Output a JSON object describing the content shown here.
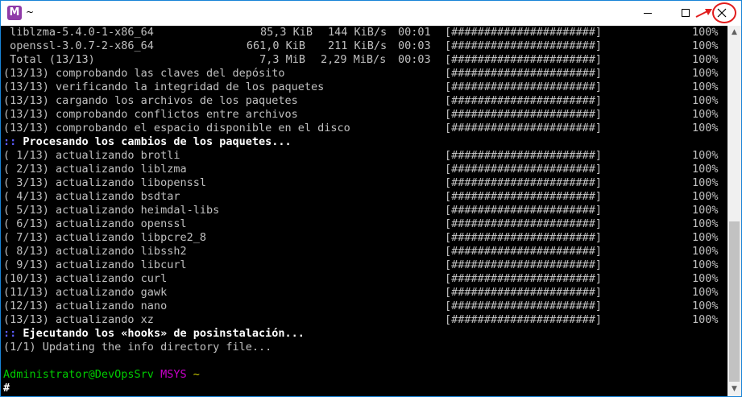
{
  "window": {
    "title": "~",
    "app_icon": "mintty-m-icon",
    "app_icon_glyph": "M"
  },
  "terminal": {
    "packages": [
      {
        "name": " liblzma-5.4.0-1-x86_64",
        "size": "85,3 KiB",
        "speed": "144 KiB/s",
        "time": "00:01",
        "bar": "[######################]",
        "pct": "100%"
      },
      {
        "name": " openssl-3.0.7-2-x86_64",
        "size": "661,0 KiB",
        "speed": "211 KiB/s",
        "time": "00:03",
        "bar": "[######################]",
        "pct": "100%"
      },
      {
        "name": " Total (13/13)",
        "size": "7,3 MiB",
        "speed": "2,29 MiB/s",
        "time": "00:03",
        "bar": "[######################]",
        "pct": "100%"
      }
    ],
    "checks": [
      {
        "text": "(13/13) comprobando las claves del depósito",
        "bar": "[######################]",
        "pct": "100%"
      },
      {
        "text": "(13/13) verificando la integridad de los paquetes",
        "bar": "[######################]",
        "pct": "100%"
      },
      {
        "text": "(13/13) cargando los archivos de los paquetes",
        "bar": "[######################]",
        "pct": "100%"
      },
      {
        "text": "(13/13) comprobando conflictos entre archivos",
        "bar": "[######################]",
        "pct": "100%"
      },
      {
        "text": "(13/13) comprobando el espacio disponible en el disco",
        "bar": "[######################]",
        "pct": "100%"
      }
    ],
    "section1": {
      "marker": "::",
      "text": " Procesando los cambios de los paquetes..."
    },
    "updates": [
      {
        "text": "( 1/13) actualizando brotli",
        "bar": "[######################]",
        "pct": "100%"
      },
      {
        "text": "( 2/13) actualizando liblzma",
        "bar": "[######################]",
        "pct": "100%"
      },
      {
        "text": "( 3/13) actualizando libopenssl",
        "bar": "[######################]",
        "pct": "100%"
      },
      {
        "text": "( 4/13) actualizando bsdtar",
        "bar": "[######################]",
        "pct": "100%"
      },
      {
        "text": "( 5/13) actualizando heimdal-libs",
        "bar": "[######################]",
        "pct": "100%"
      },
      {
        "text": "( 6/13) actualizando openssl",
        "bar": "[######################]",
        "pct": "100%"
      },
      {
        "text": "( 7/13) actualizando libpcre2_8",
        "bar": "[######################]",
        "pct": "100%"
      },
      {
        "text": "( 8/13) actualizando libssh2",
        "bar": "[######################]",
        "pct": "100%"
      },
      {
        "text": "( 9/13) actualizando libcurl",
        "bar": "[######################]",
        "pct": "100%"
      },
      {
        "text": "(10/13) actualizando curl",
        "bar": "[######################]",
        "pct": "100%"
      },
      {
        "text": "(11/13) actualizando gawk",
        "bar": "[######################]",
        "pct": "100%"
      },
      {
        "text": "(12/13) actualizando nano",
        "bar": "[######################]",
        "pct": "100%"
      },
      {
        "text": "(13/13) actualizando xz",
        "bar": "[######################]",
        "pct": "100%"
      }
    ],
    "section2": {
      "marker": "::",
      "text": " Ejecutando los «hooks» de posinstalación..."
    },
    "hook_line": "(1/1) Updating the info directory file...",
    "prompt": {
      "user_host": "Administrator@DevOpsSrv",
      "system": "MSYS",
      "path": "~",
      "symbol": "#"
    }
  },
  "colors": {
    "window_border": "#1883d7",
    "terminal_bg": "#000000",
    "terminal_fg": "#c0c0c0",
    "prompt_green": "#00cd00",
    "prompt_magenta": "#cd00cd",
    "prompt_yellow": "#cdcd00",
    "section_blue": "#5c5cff",
    "annotation_red": "#e11c1c"
  }
}
